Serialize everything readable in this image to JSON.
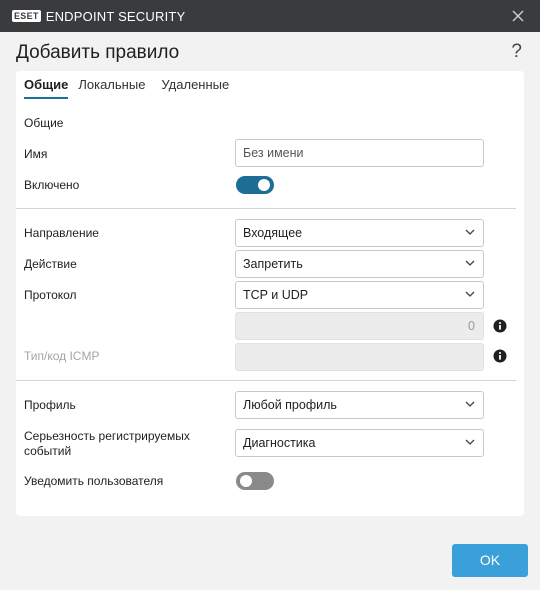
{
  "window": {
    "brand_badge": "ESET",
    "brand_title": "ENDPOINT SECURITY"
  },
  "dialog": {
    "title": "Добавить правило",
    "help": "?"
  },
  "tabs": [
    {
      "label": "Общие",
      "active": true
    },
    {
      "label": "Локальные",
      "active": false
    },
    {
      "label": "Удаленные",
      "active": false
    }
  ],
  "form": {
    "section_label": "Общие",
    "name_label": "Имя",
    "name_placeholder": "Без имени",
    "enabled_label": "Включено",
    "enabled": true,
    "direction_label": "Направление",
    "direction_value": "Входящее",
    "action_label": "Действие",
    "action_value": "Запретить",
    "protocol_label": "Протокол",
    "protocol_value": "TCP и UDP",
    "protocol_number": "0",
    "icmp_label": "Тип/код ICMP",
    "icmp_value": "",
    "profile_label": "Профиль",
    "profile_value": "Любой профиль",
    "severity_label": "Серьезность регистрируемых событий",
    "severity_value": "Диагностика",
    "notify_label": "Уведомить пользователя",
    "notify": false
  },
  "buttons": {
    "ok_label": "OK"
  },
  "colors": {
    "titlebar": "#3a3b3d",
    "accent": "#1d6e96",
    "ok_button": "#3aa0d9"
  }
}
